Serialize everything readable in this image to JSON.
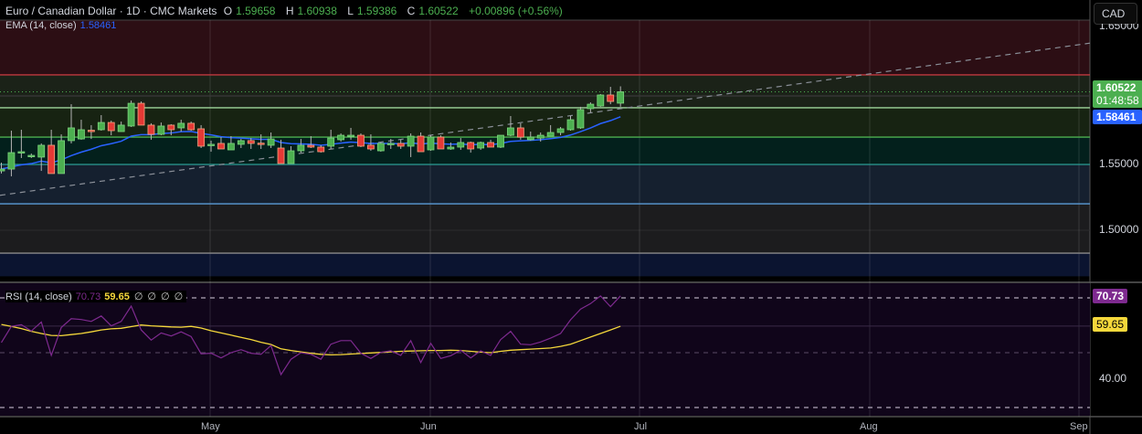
{
  "header": {
    "symbol": "Euro / Canadian Dollar · 1D · CMC Markets",
    "open_label": "O",
    "open": "1.59658",
    "high_label": "H",
    "high": "1.60938",
    "low_label": "L",
    "low": "1.59386",
    "close_label": "C",
    "close": "1.60522",
    "change": "+0.00896 (+0.56%)"
  },
  "ema_legend": {
    "label": "EMA (14, close)",
    "value": "1.58461"
  },
  "rsi_legend": {
    "label": "RSI (14, close)",
    "rsi_value": "70.73",
    "ma_value": "59.65",
    "empty": [
      "∅",
      "∅",
      "∅",
      "∅"
    ]
  },
  "price_axis": {
    "currency_button": "CAD",
    "labels": [
      "1.65000",
      "1.55000",
      "1.50000"
    ],
    "last_price": "1.60522",
    "countdown": "01:48:58",
    "ema_price": "1.58461"
  },
  "rsi_axis": {
    "rsi_tag": "70.73",
    "ma_tag": "59.65",
    "labels": [
      "40.00"
    ]
  },
  "time_axis": [
    "May",
    "Jun",
    "Jul",
    "Aug",
    "Sep"
  ],
  "colors": {
    "up": "#4caf50",
    "down": "#e53935",
    "ema": "#2962ff",
    "rsi": "#7e2a8f",
    "rsi_ma": "#f5d83b"
  },
  "chart_data": {
    "type": "candlestick",
    "title": "Euro / Canadian Dollar · 1D · CMC Markets",
    "ylim": [
      1.465,
      1.665
    ],
    "ohlc": [
      [
        1.5451,
        1.5514,
        1.5431,
        1.5465
      ],
      [
        1.5465,
        1.5757,
        1.541,
        1.559
      ],
      [
        1.559,
        1.5764,
        1.5549,
        1.5597
      ],
      [
        1.5563,
        1.5583,
        1.5549,
        1.5569
      ],
      [
        1.5556,
        1.566,
        1.5451,
        1.5646
      ],
      [
        1.5646,
        1.5764,
        1.5431,
        1.5431
      ],
      [
        1.5431,
        1.5729,
        1.5431,
        1.5681
      ],
      [
        1.5681,
        1.5958,
        1.566,
        1.5778
      ],
      [
        1.5694,
        1.584,
        1.5688,
        1.5764
      ],
      [
        1.576,
        1.5799,
        1.5694,
        1.5757
      ],
      [
        1.5764,
        1.5875,
        1.5757,
        1.5819
      ],
      [
        1.5819,
        1.5833,
        1.5722,
        1.5757
      ],
      [
        1.575,
        1.5826,
        1.575,
        1.5799
      ],
      [
        1.5792,
        1.5986,
        1.5785,
        1.5965
      ],
      [
        1.5965,
        1.5979,
        1.5799,
        1.5799
      ],
      [
        1.5799,
        1.5813,
        1.5688,
        1.5729
      ],
      [
        1.5729,
        1.5819,
        1.5722,
        1.5792
      ],
      [
        1.5799,
        1.5806,
        1.5722,
        1.5764
      ],
      [
        1.5778,
        1.584,
        1.575,
        1.5813
      ],
      [
        1.5813,
        1.5826,
        1.5757,
        1.5764
      ],
      [
        1.5771,
        1.5799,
        1.5625,
        1.5639
      ],
      [
        1.565,
        1.5681,
        1.5597,
        1.5653
      ],
      [
        1.566,
        1.5708,
        1.5618,
        1.5618
      ],
      [
        1.5611,
        1.5715,
        1.5611,
        1.566
      ],
      [
        1.5653,
        1.5694,
        1.5625,
        1.5681
      ],
      [
        1.5681,
        1.5701,
        1.5618,
        1.566
      ],
      [
        1.5662,
        1.5729,
        1.5618,
        1.566
      ],
      [
        1.5646,
        1.5743,
        1.5625,
        1.5694
      ],
      [
        1.5625,
        1.5688,
        1.5507,
        1.5507
      ],
      [
        1.5507,
        1.5639,
        1.5507,
        1.5604
      ],
      [
        1.5604,
        1.5694,
        1.559,
        1.5646
      ],
      [
        1.5646,
        1.5715,
        1.5625,
        1.5632
      ],
      [
        1.5632,
        1.5646,
        1.559,
        1.5597
      ],
      [
        1.5639,
        1.5764,
        1.5618,
        1.5701
      ],
      [
        1.5688,
        1.5736,
        1.5674,
        1.5722
      ],
      [
        1.572,
        1.5778,
        1.5688,
        1.5722
      ],
      [
        1.5722,
        1.5736,
        1.5632,
        1.5639
      ],
      [
        1.5646,
        1.5729,
        1.5604,
        1.5618
      ],
      [
        1.5604,
        1.5667,
        1.5597,
        1.566
      ],
      [
        1.5658,
        1.5694,
        1.5618,
        1.566
      ],
      [
        1.566,
        1.5688,
        1.5618,
        1.5639
      ],
      [
        1.5639,
        1.5736,
        1.5556,
        1.5715
      ],
      [
        1.5715,
        1.5743,
        1.5597,
        1.5597
      ],
      [
        1.5611,
        1.5722,
        1.5604,
        1.5708
      ],
      [
        1.5708,
        1.5722,
        1.5618,
        1.5618
      ],
      [
        1.5618,
        1.5667,
        1.5611,
        1.5632
      ],
      [
        1.5632,
        1.5701,
        1.5611,
        1.5667
      ],
      [
        1.5667,
        1.5674,
        1.559,
        1.5618
      ],
      [
        1.5625,
        1.5674,
        1.5611,
        1.5667
      ],
      [
        1.5667,
        1.5688,
        1.5632,
        1.5632
      ],
      [
        1.5632,
        1.5722,
        1.5625,
        1.5722
      ],
      [
        1.5722,
        1.5868,
        1.5715,
        1.5778
      ],
      [
        1.5778,
        1.5813,
        1.5688,
        1.5708
      ],
      [
        1.5688,
        1.575,
        1.5681,
        1.5708
      ],
      [
        1.5701,
        1.5743,
        1.5674,
        1.5722
      ],
      [
        1.5715,
        1.5799,
        1.5715,
        1.5743
      ],
      [
        1.5743,
        1.5785,
        1.5722,
        1.5771
      ],
      [
        1.5764,
        1.5868,
        1.5757,
        1.584
      ],
      [
        1.5778,
        1.5938,
        1.5771,
        1.5917
      ],
      [
        1.5924,
        1.5972,
        1.5896,
        1.5958
      ],
      [
        1.5944,
        1.6035,
        1.5938,
        1.6028
      ],
      [
        1.6028,
        1.609,
        1.5958,
        1.5979
      ],
      [
        1.59658,
        1.60938,
        1.59386,
        1.60522
      ]
    ],
    "ema_period": 14,
    "levels": [
      {
        "price": 1.6181,
        "color": "#c0393f"
      },
      {
        "price": 1.6021,
        "color": "#3a3a3a"
      },
      {
        "price": 1.5931,
        "color": "#9ed59a"
      },
      {
        "price": 1.5708,
        "color": "#4caf50"
      },
      {
        "price": 1.55,
        "color": "#2a9d94"
      },
      {
        "price": 1.5201,
        "color": "#5b9bd5"
      },
      {
        "price": 1.4826,
        "color": "#8a8a8a"
      }
    ],
    "zones": [
      {
        "from": 1.6181,
        "to": 1.665,
        "color": "#2c0e14"
      },
      {
        "from": 1.5931,
        "to": 1.6181,
        "color": "#1b2218"
      },
      {
        "from": 1.5708,
        "to": 1.5931,
        "color": "#172312"
      },
      {
        "from": 1.55,
        "to": 1.5708,
        "color": "#03201c"
      },
      {
        "from": 1.5201,
        "to": 1.55,
        "color": "#15202f"
      },
      {
        "from": 1.4826,
        "to": 1.5201,
        "color": "#1c1c1e"
      },
      {
        "from": 1.465,
        "to": 1.4826,
        "color": "#0b1430"
      }
    ],
    "trendline": {
      "start_index": 0,
      "start_price": 1.5267,
      "end_index": 62,
      "end_price": 1.5924
    },
    "rsi": {
      "ylim": [
        27,
        78
      ],
      "bands": [
        70,
        50,
        30
      ],
      "values": [
        53.7,
        59.6,
        60.2,
        57.9,
        61.2,
        49.0,
        59.2,
        62.4,
        62.1,
        61.4,
        63.4,
        59.8,
        61.4,
        67.0,
        58.3,
        54.6,
        57.2,
        56.1,
        57.6,
        55.9,
        49.6,
        49.8,
        48.1,
        50.0,
        51.1,
        49.8,
        49.4,
        52.6,
        42.0,
        47.6,
        50.0,
        49.4,
        47.6,
        53.1,
        54.4,
        54.4,
        49.8,
        47.9,
        50.1,
        50.7,
        49.0,
        54.4,
        46.4,
        53.4,
        47.9,
        48.9,
        50.9,
        48.1,
        50.7,
        49.0,
        54.8,
        57.8,
        53.1,
        52.9,
        53.9,
        55.3,
        57.0,
        62.0,
        65.9,
        67.9,
        70.7,
        66.8,
        70.73
      ],
      "ma": [
        60.3,
        59.6,
        58.8,
        57.8,
        57.0,
        56.3,
        56.2,
        56.6,
        57.0,
        57.6,
        58.3,
        58.7,
        58.9,
        59.5,
        60.1,
        59.8,
        59.6,
        59.4,
        59.3,
        59.6,
        59.0,
        58.0,
        57.2,
        56.4,
        55.6,
        54.8,
        53.8,
        53.0,
        51.4,
        50.8,
        50.3,
        49.8,
        49.4,
        49.2,
        49.3,
        49.5,
        49.7,
        49.9,
        50.1,
        50.3,
        50.5,
        50.6,
        50.7,
        50.8,
        50.8,
        50.9,
        50.8,
        50.5,
        50.2,
        50.0,
        50.5,
        50.9,
        51.1,
        51.3,
        51.5,
        51.7,
        52.3,
        53.1,
        54.4,
        55.7,
        57.0,
        58.3,
        59.65
      ]
    }
  }
}
